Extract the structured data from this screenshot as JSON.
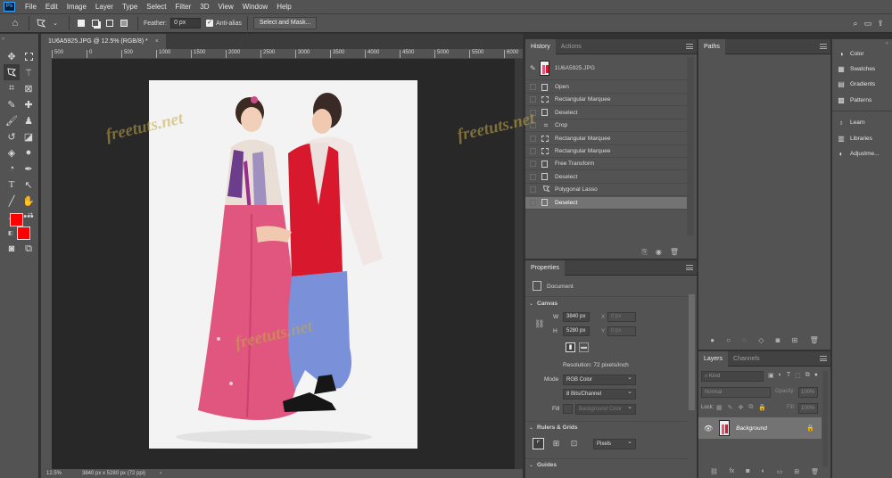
{
  "menu": {
    "app_icon": "Ps",
    "items": [
      "File",
      "Edit",
      "Image",
      "Layer",
      "Type",
      "Select",
      "Filter",
      "3D",
      "View",
      "Window",
      "Help"
    ]
  },
  "window_controls": {
    "search_icon": "search-icon",
    "workspace_icon": "workspace-icon",
    "share_icon": "share-icon"
  },
  "options": {
    "feather_label": "Feather:",
    "feather_value": "0 px",
    "antialias_label": "Anti-alias",
    "select_mask_label": "Select and Mask..."
  },
  "document": {
    "tab_title": "1U6A5925.JPG @ 12.5% (RGB/8) *",
    "close": "×",
    "ruler_ticks": [
      "500",
      "0",
      "500",
      "1000",
      "1500",
      "2000",
      "2500",
      "3000",
      "3500",
      "4000",
      "4500",
      "5000",
      "5500",
      "6000"
    ],
    "zoom": "12.5%",
    "size_info": "3840 px x 5280 px (72 ppi)",
    "status_arrow": "›"
  },
  "history": {
    "tabs": [
      "History",
      "Actions"
    ],
    "snapshot": "1U6A5925.JPG",
    "rows": [
      {
        "label": "Open",
        "icon": "document-icon"
      },
      {
        "label": "Rectangular Marquee",
        "icon": "marquee-icon"
      },
      {
        "label": "Deselect",
        "icon": "document-icon"
      },
      {
        "label": "Crop",
        "icon": "crop-icon"
      },
      {
        "label": "Rectangular Marquee",
        "icon": "marquee-icon"
      },
      {
        "label": "Rectangular Marquee",
        "icon": "marquee-icon"
      },
      {
        "label": "Free Transform",
        "icon": "document-icon"
      },
      {
        "label": "Deselect",
        "icon": "document-icon"
      },
      {
        "label": "Polygonal Lasso",
        "icon": "lasso-icon"
      },
      {
        "label": "Deselect",
        "icon": "document-icon"
      }
    ],
    "selected_index": 9
  },
  "properties": {
    "title": "Properties",
    "doc_label": "Document",
    "canvas_title": "Canvas",
    "w_label": "W",
    "w_value": "3840 px",
    "h_label": "H",
    "h_value": "5280 px",
    "x_label": "X",
    "x_value": "0 px",
    "y_label": "Y",
    "y_value": "0 px",
    "resolution": "Resolution: 72 pixels/inch",
    "mode_label": "Mode",
    "mode_value": "RGB Color",
    "depth_value": "8 Bits/Channel",
    "fill_label": "Fill",
    "fill_value": "Background Color",
    "rulers_title": "Rulers & Grids",
    "units_value": "Pixels",
    "guides_title": "Guides"
  },
  "paths": {
    "title": "Paths"
  },
  "layers": {
    "tabs": [
      "Layers",
      "Channels"
    ],
    "kind_placeholder": "Kind",
    "blend_mode": "Normal",
    "opacity_label": "Opacity:",
    "opacity_value": "100%",
    "lock_label": "Lock:",
    "fill_label": "Fill:",
    "fill_value": "100%",
    "layer_name": "Background"
  },
  "right_panels": [
    {
      "label": "Color",
      "icon": "color-wheel-icon"
    },
    {
      "label": "Swatches",
      "icon": "swatches-icon"
    },
    {
      "label": "Gradients",
      "icon": "gradients-icon"
    },
    {
      "label": "Patterns",
      "icon": "patterns-icon"
    },
    {
      "label": "Learn",
      "icon": "lightbulb-icon"
    },
    {
      "label": "Libraries",
      "icon": "libraries-icon"
    },
    {
      "label": "Adjustme...",
      "icon": "adjustments-icon"
    }
  ],
  "colors": {
    "foreground": "#ff0000",
    "background": "#ff0000",
    "accent": "#31a8ff"
  },
  "watermark": "freetuts.net"
}
